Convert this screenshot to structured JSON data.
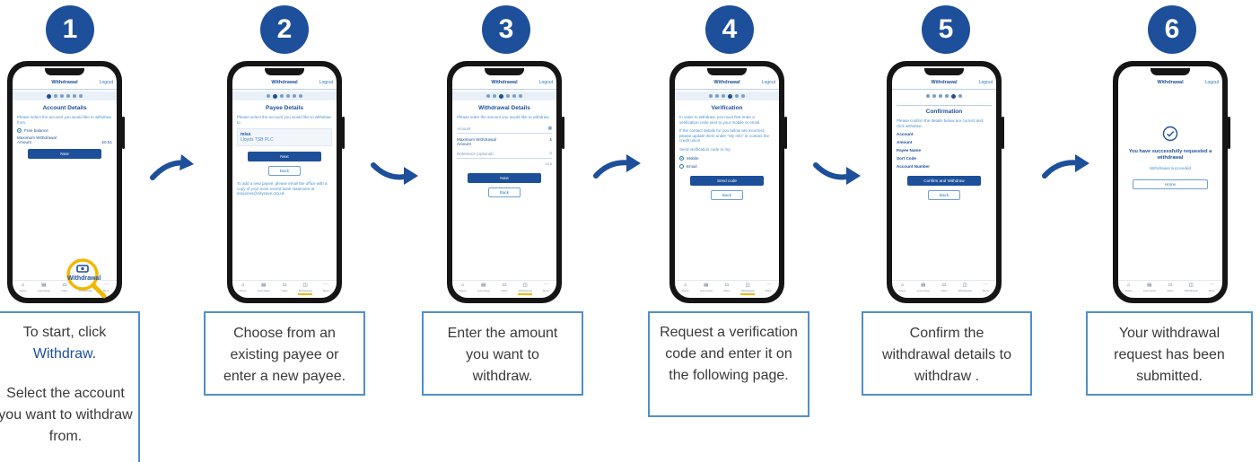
{
  "colors": {
    "badge": "#1d4f9a",
    "primary": "#1d4f9a",
    "link": "#2f78c0",
    "caption_border": "#4f8fc9",
    "highlight": "#f2b705",
    "arrow": "#1d4f9a"
  },
  "nav_labels": [
    "Home",
    "Loan Apps",
    "Inbox",
    "Withdrawal",
    "More"
  ],
  "steps": [
    {
      "number": "1",
      "screen": {
        "title": "Withdrawal",
        "logout": "Logout",
        "section_title": "Account Details",
        "prompt": "Please select the account you would like to withdraw from",
        "option": "Free balance",
        "max_label": "Maximum Withdrawal Amount",
        "max_value": "£0.51",
        "button": "Next",
        "callout_label": "Withdrawal"
      },
      "caption": {
        "line1": "To start, click",
        "emphasis": "Withdraw",
        "after_emphasis": ".",
        "line2": "Select the account you want to withdraw from."
      }
    },
    {
      "number": "2",
      "screen": {
        "title": "Withdrawal",
        "logout": "Logout",
        "section_title": "Payee Details",
        "prompt": "Please select the account you would like to withdraw to",
        "payee_name": "miss",
        "payee_bank": "Lloyds TSB PLC",
        "button_primary": "Next",
        "button_secondary": "Back",
        "note": "To add a new payee, please email the office with a copy of your most recent bank statement at enquiries@citysave.org.uk"
      },
      "caption": {
        "text": "Choose from an existing payee or enter a new payee."
      }
    },
    {
      "number": "3",
      "screen": {
        "title": "Withdrawal",
        "logout": "Logout",
        "section_title": "Withdrawal Details",
        "prompt": "Please enter the amount you would like to withdraw",
        "amount_label": "Amount",
        "max_label": "Maximum Withdrawal Amount",
        "max_value": "£",
        "reference_label": "Reference (optional)",
        "char_count": "0/18",
        "button_primary": "Next",
        "button_secondary": "Back"
      },
      "caption": {
        "text": "Enter the amount you want to withdraw."
      }
    },
    {
      "number": "4",
      "screen": {
        "title": "Withdrawal",
        "logout": "Logout",
        "section_title": "Verification",
        "prompt": "In order to withdraw, you must first enter a verification code sent to your mobile or email.",
        "prompt2": "If the contact details for you below are incorrect, please update them under \"My Info\" or contact the credit union",
        "send_to": "Send verification code to my:",
        "option1": "Mobile",
        "option2": "Email",
        "button_primary": "Send code",
        "button_secondary": "Back"
      },
      "caption": {
        "text": "Request a verification code and enter it on the following page."
      }
    },
    {
      "number": "5",
      "screen": {
        "title": "Withdrawal",
        "logout": "Logout",
        "section_title": "Confirmation",
        "prompt": "Please confirm the details below are correct and click withdraw",
        "fields": [
          "Account",
          "Amount",
          "Payee Name",
          "Sort Code",
          "Account Number"
        ],
        "button_primary": "Confirm and Withdraw",
        "button_secondary": "Back"
      },
      "caption": {
        "text": "Confirm the withdrawal details to withdraw ."
      }
    },
    {
      "number": "6",
      "screen": {
        "title": "Withdrawal",
        "logout": "Logout",
        "success_title": "You have successfully requested a withdrawal",
        "success_sub": "Withdrawal succeeded",
        "button": "Home"
      },
      "caption": {
        "text": "Your withdrawal request has been submitted."
      }
    }
  ]
}
